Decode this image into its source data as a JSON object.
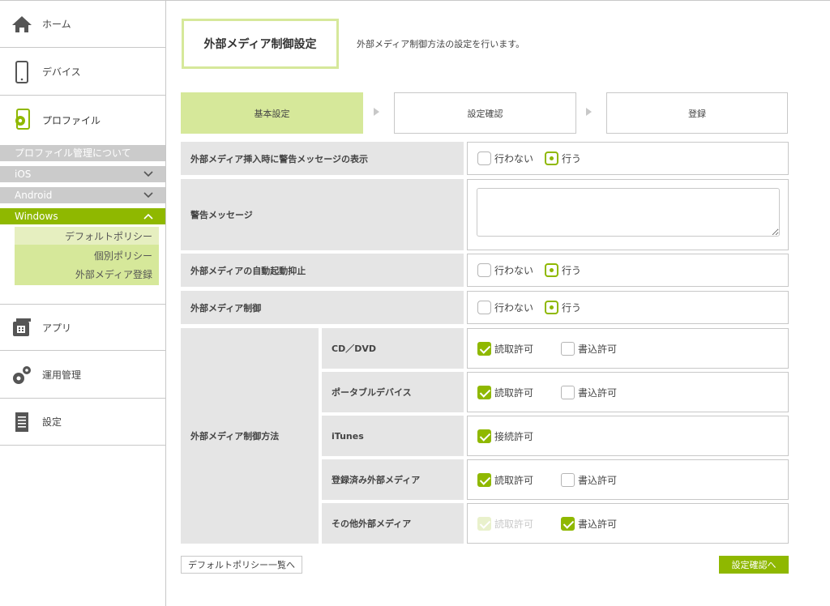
{
  "sidebar": {
    "home": "ホーム",
    "device": "デバイス",
    "profile": "プロファイル",
    "sub": {
      "about": "プロファイル管理について",
      "ios": "iOS",
      "android": "Android",
      "windows": "Windows"
    },
    "windows_items": [
      "デフォルトポリシー",
      "個別ポリシー",
      "外部メディア登録"
    ],
    "app": "アプリ",
    "ops": "運用管理",
    "settings": "設定"
  },
  "header": {
    "title": "外部メディア制御設定",
    "description": "外部メディア制御方法の設定を行います。"
  },
  "steps": [
    "基本設定",
    "設定確認",
    "登録"
  ],
  "form": {
    "warn_display": {
      "label": "外部メディア挿入時に警告メッセージの表示",
      "options": [
        "行わない",
        "行う"
      ],
      "selected": "行う"
    },
    "warn_message": {
      "label": "警告メッセージ",
      "value": ""
    },
    "autorun": {
      "label": "外部メディアの自動起動抑止",
      "options": [
        "行わない",
        "行う"
      ],
      "selected": "行う"
    },
    "control": {
      "label": "外部メディア制御",
      "options": [
        "行わない",
        "行う"
      ],
      "selected": "行う"
    },
    "method": {
      "label": "外部メディア制御方法",
      "rows": [
        {
          "name": "CD／DVD",
          "read": "読取許可",
          "write": "書込許可",
          "read_checked": true,
          "write_checked": false
        },
        {
          "name": "ポータブルデバイス",
          "read": "読取許可",
          "write": "書込許可",
          "read_checked": true,
          "write_checked": false
        },
        {
          "name": "iTunes",
          "connect": "接続許可",
          "connect_checked": true
        },
        {
          "name": "登録済み外部メディア",
          "read": "読取許可",
          "write": "書込許可",
          "read_checked": true,
          "write_checked": false
        },
        {
          "name": "その他外部メディア",
          "read": "読取許可",
          "write": "書込許可",
          "read_checked": true,
          "read_disabled": true,
          "write_checked": true
        }
      ]
    }
  },
  "footer": {
    "default_list": "デフォルトポリシー一覧へ",
    "confirm": "設定確認へ"
  },
  "colors": {
    "accent": "#8fb800",
    "accent_light": "#d6e89a",
    "label_bg": "#e5e5e5"
  }
}
